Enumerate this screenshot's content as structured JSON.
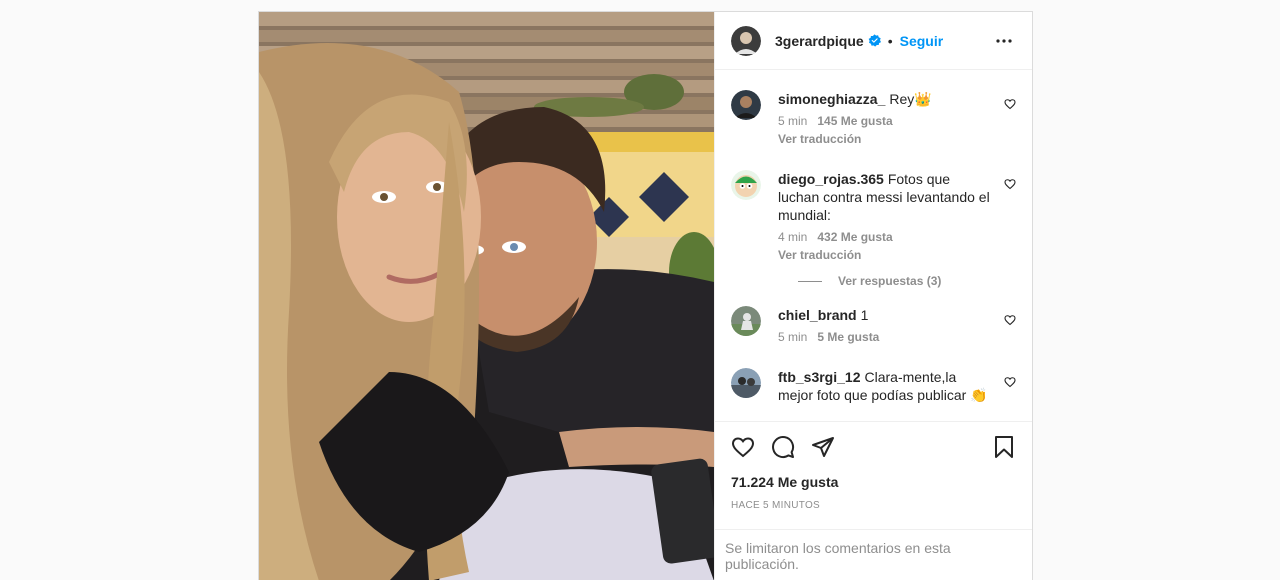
{
  "post": {
    "author": "3gerardpique",
    "separator": "•",
    "follow_label": "Seguir",
    "likes_total": "71.224 Me gusta",
    "time_ago": "HACE 5 MINUTOS",
    "comments_limited_text": "Se limitaron los comentarios en esta publicación."
  },
  "comments": [
    {
      "user": "simoneghiazza_",
      "text": "Rey👑",
      "time": "5 min",
      "likes": "145 Me gusta",
      "translate": "Ver traducción"
    },
    {
      "user": "diego_rojas.365",
      "text": "Fotos que luchan contra messi levantando el mundial:",
      "time": "4 min",
      "likes": "432 Me gusta",
      "translate": "Ver traducción",
      "replies": "Ver respuestas (3)"
    },
    {
      "user": "chiel_brand",
      "text": "1",
      "time": "5 min",
      "likes": "5 Me gusta"
    },
    {
      "user": "ftb_s3rgi_12",
      "text": "Clara-mente,la mejor foto que podías publicar 👏"
    }
  ],
  "icons": {
    "verified": "verified-badge-icon",
    "more": "more-options-icon",
    "heart": "heart-icon",
    "comment": "comment-icon",
    "share": "share-icon",
    "save": "bookmark-icon"
  },
  "colors": {
    "accent": "#0095f6",
    "text": "#262626",
    "muted": "#8e8e8e",
    "border": "#dbdbdb"
  }
}
